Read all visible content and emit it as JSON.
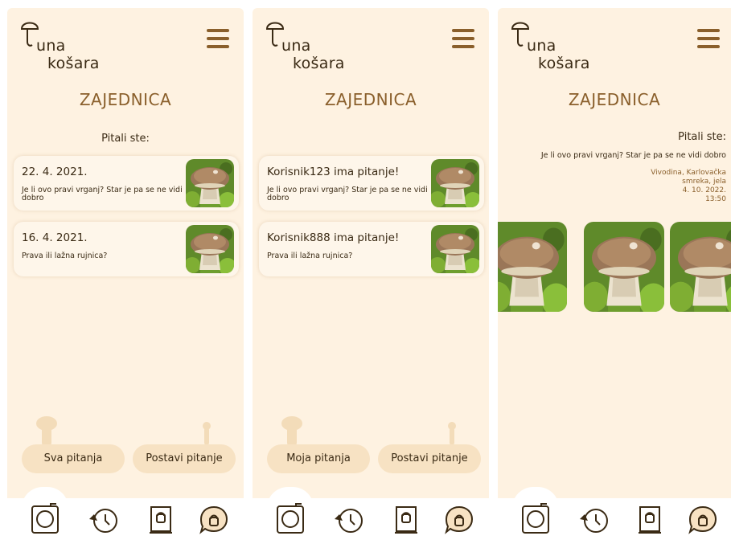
{
  "brand": {
    "line1": "una",
    "line2": "košara"
  },
  "screens": [
    {
      "title": "ZAJEDNICA",
      "subtitle": "Pitali ste:",
      "cards": [
        {
          "heading": "22. 4. 2021.",
          "question": "Je li ovo pravi vrganj? Star je pa se ne vidi dobro"
        },
        {
          "heading": "16. 4. 2021.",
          "question": "Prava ili lažna rujnica?"
        }
      ],
      "buttons": {
        "left": "Sva pitanja",
        "right": "Postavi pitanje"
      }
    },
    {
      "title": "ZAJEDNICA",
      "cards": [
        {
          "heading": "Korisnik123 ima pitanje!",
          "question": "Je li ovo pravi vrganj? Star je pa se ne vidi dobro"
        },
        {
          "heading": "Korisnik888 ima pitanje!",
          "question": "Prava ili lažna rujnica?"
        }
      ],
      "buttons": {
        "left": "Moja pitanja",
        "right": "Postavi pitanje"
      }
    },
    {
      "title": "ZAJEDNICA",
      "subtitle": "Pitali ste:",
      "question": "Je li ovo pravi vrganj? Star je pa se ne vidi dobro",
      "location": "Vivodina, Karlovačka",
      "trees": "smreka, jela",
      "date": "4. 10. 2022.",
      "time": "13:50"
    }
  ],
  "nav_icons": [
    "camera-icon",
    "history-icon",
    "book-icon",
    "community-icon"
  ],
  "colors": {
    "background": "#fef2e1",
    "accent": "#8a5f2b",
    "pill": "#f7e2c3",
    "text": "#3a2a14"
  }
}
